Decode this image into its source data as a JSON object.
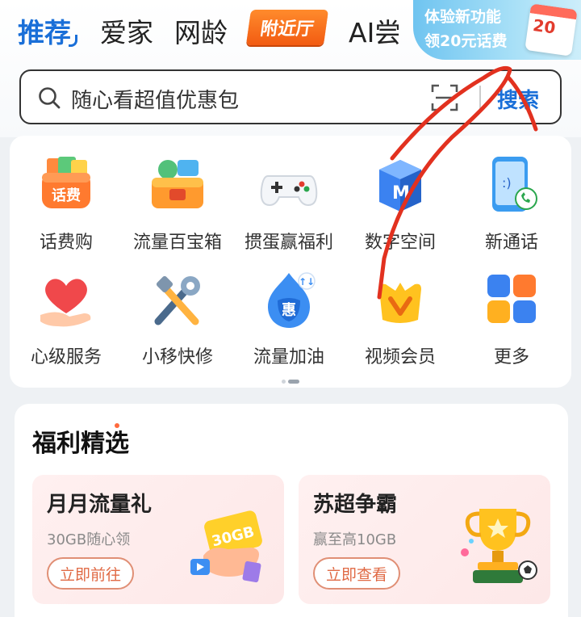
{
  "tabs": [
    {
      "label": "推荐"
    },
    {
      "label": "爱家"
    },
    {
      "label": "网龄"
    },
    {
      "label": "附近厅"
    },
    {
      "label": "AI尝"
    }
  ],
  "promo": {
    "line1": "体验新功能",
    "line2": "领20元话费",
    "calendar_text": "20"
  },
  "search": {
    "placeholder": "随心看超值优惠包",
    "button": "搜索"
  },
  "grid": [
    {
      "label": "话费购",
      "icon": "phone-bill-bag-icon"
    },
    {
      "label": "流量百宝箱",
      "icon": "treasure-box-icon"
    },
    {
      "label": "掼蛋赢福利",
      "icon": "gamepad-icon"
    },
    {
      "label": "数字空间",
      "icon": "digital-space-icon"
    },
    {
      "label": "新通话",
      "icon": "new-call-icon"
    },
    {
      "label": "心级服务",
      "icon": "heart-hand-icon"
    },
    {
      "label": "小移快修",
      "icon": "repair-tools-icon"
    },
    {
      "label": "流量加油",
      "icon": "data-boost-icon"
    },
    {
      "label": "视频会员",
      "icon": "video-vip-icon"
    },
    {
      "label": "更多",
      "icon": "more-grid-icon"
    }
  ],
  "benefits": {
    "title": "福利精选",
    "cards": [
      {
        "title": "月月流量礼",
        "subtitle": "30GB随心领",
        "button": "立即前往",
        "art_text": "30GB"
      },
      {
        "title": "苏超争霸",
        "subtitle": "赢至高10GB",
        "button": "立即查看"
      }
    ]
  },
  "colors": {
    "accent": "#1a6fd8",
    "badge": "#f25b12",
    "scribble": "#e2311f"
  }
}
